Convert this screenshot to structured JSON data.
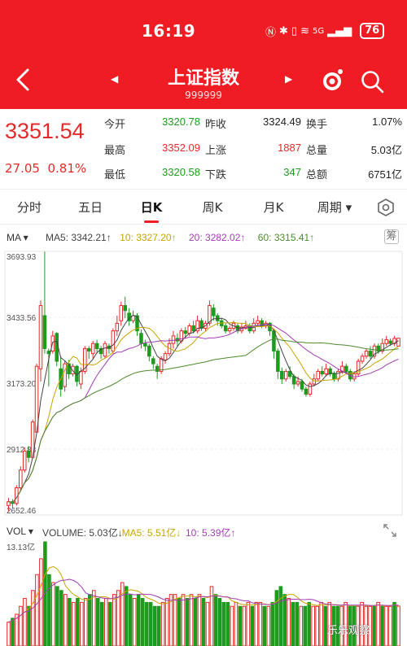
{
  "status_bar": {
    "time": "16:19",
    "network": "5G",
    "battery": "76"
  },
  "header": {
    "title": "上证指数",
    "code": "999999"
  },
  "quote": {
    "price": "3351.54",
    "change": "27.05",
    "change_pct": "0.81%",
    "stats": [
      {
        "label": "今开",
        "value": "3320.78",
        "color": "#1e9b1e"
      },
      {
        "label": "昨收",
        "value": "3324.49",
        "color": "#222222"
      },
      {
        "label": "换手",
        "value": "1.07%",
        "color": "#222222"
      },
      {
        "label": "最高",
        "value": "3352.09",
        "color": "#e32a2a"
      },
      {
        "label": "上涨",
        "value": "1887",
        "color": "#e32a2a"
      },
      {
        "label": "总量",
        "value": "5.03亿",
        "color": "#222222"
      },
      {
        "label": "最低",
        "value": "3320.58",
        "color": "#1e9b1e"
      },
      {
        "label": "下跌",
        "value": "347",
        "color": "#1e9b1e"
      },
      {
        "label": "总额",
        "value": "6751亿",
        "color": "#222222"
      }
    ]
  },
  "tabs": [
    {
      "label": "分时",
      "active": false
    },
    {
      "label": "五日",
      "active": false
    },
    {
      "label": "日K",
      "active": true
    },
    {
      "label": "周K",
      "active": false
    },
    {
      "label": "月K",
      "active": false
    },
    {
      "label": "周期",
      "active": false
    }
  ],
  "ma_legend": {
    "type": "MA",
    "items": [
      {
        "text": "MA5: 3342.21↑",
        "color": "#444444"
      },
      {
        "text": "10: 3327.20↑",
        "color": "#c8a400"
      },
      {
        "text": "20: 3282.02↑",
        "color": "#a23cb4"
      },
      {
        "text": "60: 3315.41↑",
        "color": "#4d8a2d"
      }
    ],
    "tools_label": "筹"
  },
  "price_axis": [
    "3693.93",
    "3433.56",
    "3173.20",
    "2912.83",
    "2652.46"
  ],
  "vol_legend": {
    "type": "VOL",
    "items": [
      {
        "text": "VOLUME: 5.03亿↓",
        "color": "#444444"
      },
      {
        "text": "MA5: 5.51亿↓",
        "color": "#c8a400"
      },
      {
        "text": "10: 5.39亿↑",
        "color": "#a23cb4"
      }
    ],
    "max_label": "13.13亿"
  },
  "watermark": "乐乐观察",
  "chart_data": {
    "type": "candlestick",
    "ylim": [
      2652.46,
      3693.93
    ],
    "candles": [
      [
        2690,
        2705,
        2665,
        2720
      ],
      [
        2705,
        2698,
        2680,
        2715
      ],
      [
        2698,
        2760,
        2690,
        2770
      ],
      [
        2760,
        2830,
        2750,
        2845
      ],
      [
        2830,
        2905,
        2820,
        2920
      ],
      [
        2905,
        2880,
        2860,
        2925
      ],
      [
        2880,
        3020,
        2875,
        3030
      ],
      [
        2980,
        3240,
        2975,
        3250
      ],
      [
        3230,
        3480,
        3180,
        3500
      ],
      [
        3440,
        3310,
        3290,
        3693
      ],
      [
        3300,
        3290,
        3160,
        3310
      ],
      [
        3300,
        3360,
        3290,
        3380
      ],
      [
        3370,
        3260,
        3240,
        3375
      ],
      [
        3230,
        3150,
        3120,
        3280
      ],
      [
        3160,
        3250,
        3140,
        3260
      ],
      [
        3250,
        3210,
        3190,
        3265
      ],
      [
        3210,
        3240,
        3200,
        3250
      ],
      [
        3240,
        3180,
        3160,
        3245
      ],
      [
        3170,
        3220,
        3150,
        3235
      ],
      [
        3220,
        3310,
        3210,
        3320
      ],
      [
        3310,
        3300,
        3270,
        3320
      ],
      [
        3290,
        3330,
        3270,
        3340
      ],
      [
        3330,
        3310,
        3290,
        3345
      ],
      [
        3310,
        3290,
        3270,
        3320
      ],
      [
        3280,
        3330,
        3270,
        3340
      ],
      [
        3320,
        3310,
        3290,
        3330
      ],
      [
        3300,
        3380,
        3290,
        3390
      ],
      [
        3380,
        3410,
        3360,
        3440
      ],
      [
        3420,
        3480,
        3400,
        3495
      ],
      [
        3480,
        3460,
        3430,
        3515
      ],
      [
        3450,
        3420,
        3400,
        3470
      ],
      [
        3420,
        3440,
        3410,
        3460
      ],
      [
        3440,
        3380,
        3360,
        3450
      ],
      [
        3370,
        3330,
        3310,
        3385
      ],
      [
        3330,
        3320,
        3300,
        3345
      ],
      [
        3320,
        3280,
        3260,
        3330
      ],
      [
        3270,
        3250,
        3230,
        3280
      ],
      [
        3240,
        3220,
        3190,
        3250
      ],
      [
        3220,
        3270,
        3210,
        3280
      ],
      [
        3265,
        3290,
        3250,
        3300
      ],
      [
        3290,
        3330,
        3280,
        3350
      ],
      [
        3330,
        3360,
        3310,
        3380
      ],
      [
        3350,
        3340,
        3320,
        3370
      ],
      [
        3340,
        3380,
        3330,
        3390
      ],
      [
        3380,
        3370,
        3350,
        3395
      ],
      [
        3370,
        3400,
        3360,
        3410
      ],
      [
        3400,
        3380,
        3370,
        3420
      ],
      [
        3380,
        3420,
        3370,
        3440
      ],
      [
        3420,
        3390,
        3380,
        3430
      ],
      [
        3390,
        3410,
        3380,
        3420
      ],
      [
        3410,
        3480,
        3400,
        3500
      ],
      [
        3470,
        3440,
        3420,
        3485
      ],
      [
        3440,
        3420,
        3400,
        3450
      ],
      [
        3420,
        3400,
        3390,
        3430
      ],
      [
        3400,
        3380,
        3370,
        3410
      ],
      [
        3380,
        3390,
        3370,
        3400
      ],
      [
        3390,
        3410,
        3380,
        3420
      ],
      [
        3400,
        3380,
        3370,
        3410
      ],
      [
        3380,
        3395,
        3370,
        3410
      ],
      [
        3390,
        3400,
        3385,
        3420
      ],
      [
        3400,
        3380,
        3370,
        3410
      ],
      [
        3380,
        3410,
        3370,
        3430
      ],
      [
        3410,
        3420,
        3400,
        3440
      ],
      [
        3420,
        3400,
        3390,
        3430
      ],
      [
        3400,
        3410,
        3390,
        3420
      ],
      [
        3410,
        3380,
        3360,
        3415
      ],
      [
        3380,
        3300,
        3270,
        3385
      ],
      [
        3300,
        3220,
        3190,
        3310
      ],
      [
        3220,
        3190,
        3170,
        3235
      ],
      [
        3190,
        3220,
        3180,
        3230
      ],
      [
        3220,
        3200,
        3190,
        3240
      ],
      [
        3200,
        3170,
        3150,
        3210
      ],
      [
        3170,
        3180,
        3160,
        3200
      ],
      [
        3180,
        3150,
        3140,
        3190
      ],
      [
        3150,
        3130,
        3120,
        3160
      ],
      [
        3130,
        3170,
        3120,
        3180
      ],
      [
        3170,
        3190,
        3160,
        3210
      ],
      [
        3190,
        3220,
        3180,
        3230
      ],
      [
        3220,
        3210,
        3200,
        3240
      ],
      [
        3210,
        3230,
        3200,
        3250
      ],
      [
        3230,
        3210,
        3200,
        3240
      ],
      [
        3210,
        3190,
        3180,
        3220
      ],
      [
        3190,
        3220,
        3180,
        3230
      ],
      [
        3220,
        3240,
        3210,
        3260
      ],
      [
        3240,
        3220,
        3210,
        3250
      ],
      [
        3220,
        3190,
        3180,
        3230
      ],
      [
        3190,
        3210,
        3180,
        3220
      ],
      [
        3210,
        3260,
        3200,
        3270
      ],
      [
        3260,
        3280,
        3250,
        3290
      ],
      [
        3280,
        3300,
        3270,
        3310
      ],
      [
        3300,
        3280,
        3270,
        3320
      ],
      [
        3280,
        3320,
        3270,
        3330
      ],
      [
        3320,
        3300,
        3290,
        3330
      ],
      [
        3300,
        3330,
        3290,
        3350
      ],
      [
        3330,
        3345,
        3320,
        3360
      ],
      [
        3340,
        3330,
        3320,
        3350
      ],
      [
        3330,
        3350,
        3320,
        3360
      ],
      [
        3320,
        3351,
        3320,
        3352
      ]
    ],
    "volume": {
      "ylim": [
        0,
        13.13
      ],
      "values": [
        3,
        3.5,
        4,
        5,
        6,
        5,
        7,
        9,
        11,
        13.13,
        9,
        8,
        7.5,
        7,
        6.5,
        6,
        5.5,
        6,
        5.5,
        6,
        6.5,
        7,
        6,
        5.5,
        6,
        5.5,
        6.5,
        7,
        8,
        7.5,
        6.5,
        6,
        6.5,
        6,
        5.5,
        5.5,
        5,
        5,
        5.5,
        6,
        6.5,
        6.5,
        6,
        6.5,
        6,
        6.5,
        6,
        6.5,
        6,
        5.5,
        7.5,
        6.5,
        6,
        5.5,
        5.5,
        5,
        5.5,
        5,
        5,
        5.5,
        5,
        5.5,
        5.5,
        5,
        5,
        5.5,
        7,
        7.5,
        6.5,
        6,
        5.5,
        5.5,
        5,
        5,
        5.5,
        5,
        5,
        5.5,
        5,
        5.5,
        5,
        5,
        5,
        5.5,
        5,
        5,
        5,
        5.5,
        5,
        5,
        5,
        5.5,
        5,
        5,
        5,
        5.5,
        5.03
      ]
    }
  }
}
